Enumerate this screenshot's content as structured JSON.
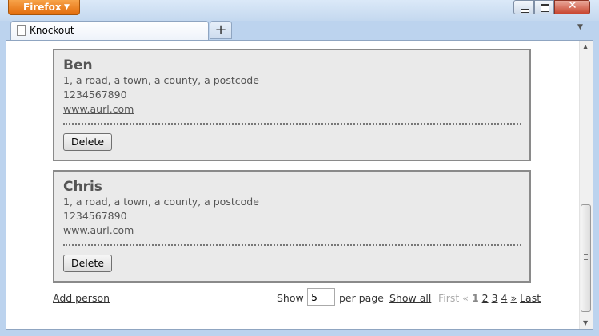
{
  "window": {
    "app_button": "Firefox",
    "tab_title": "Knockout",
    "new_tab_label": "+"
  },
  "people": [
    {
      "name": "Ben",
      "address": "1, a road, a town, a county, a postcode",
      "phone": "1234567890",
      "url": "www.aurl.com",
      "delete_label": "Delete"
    },
    {
      "name": "Chris",
      "address": "1, a road, a town, a county, a postcode",
      "phone": "1234567890",
      "url": "www.aurl.com",
      "delete_label": "Delete"
    }
  ],
  "footer": {
    "add_person": "Add person",
    "show": "Show",
    "per_page_value": "5",
    "per_page": "per page",
    "show_all": "Show all",
    "pager": {
      "first": "First",
      "prev": "«",
      "current": "1",
      "pages": [
        "2",
        "3",
        "4"
      ],
      "next": "»",
      "last": "Last"
    }
  },
  "colors": {
    "firefox_button": "#e36c0b",
    "card_background": "#eaeaea",
    "card_border": "#8a8a8a"
  }
}
